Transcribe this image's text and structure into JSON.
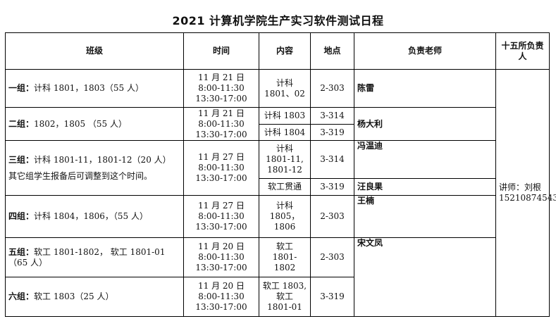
{
  "title": "2021 计算机学院生产实习软件测试日程",
  "headers": {
    "class": "班级",
    "time": "时间",
    "content": "内容",
    "location": "地点",
    "teacher": "负责老师",
    "leader": "十五所负责人"
  },
  "rows": [
    {
      "group_label": "一组：",
      "group_text": "计科 1801，1803（55 人）",
      "time": "11 月 21 日\n8:00-11:30\n13:30-17:00",
      "content": "计科 1801、02",
      "location": "2-303",
      "teacher": "陈雷"
    },
    {
      "group_label": "二组：",
      "group_text": "1802，1805 （55 人）",
      "time": "11 月 21 日\n8:00-11:30\n13:30-17:00",
      "sessions": [
        {
          "content": "计科 1803",
          "location": "3-314"
        },
        {
          "content": "计科 1804",
          "location": "3-319"
        }
      ],
      "teacher": "杨大利"
    },
    {
      "group_label": "三组：",
      "group_text": "计科 1801-11，1801-12（20 人）",
      "note": "其它组学生报备后可调整到这个时间。",
      "time": "11 月 27 日\n8:00-11:30\n13:30-17:00",
      "sessions": [
        {
          "content": "计科\n1801-11,\n1801-12",
          "location": "3-314",
          "teacher": "冯温迪"
        },
        {
          "content": "软工贯通",
          "location": "3-319",
          "teacher": "汪良果"
        }
      ]
    },
    {
      "group_label": "四组：",
      "group_text": "计科 1804，1806，（55 人）",
      "time": "11 月 27 日\n8:00-11:30\n13:30-17:00",
      "content": "计科 1805，1806",
      "location": "2-303",
      "teacher": "王楠"
    },
    {
      "group_label": "五组：",
      "group_text": "软工 1801-1802， 软工 1801-01（65 人）",
      "time": "11 月 20 日\n8:00-11:30\n13:30-17:00",
      "content": "软工\n1801-1802",
      "location": "2-303",
      "teacher": "宋文凤"
    },
    {
      "group_label": "六组：",
      "group_text": "软工 1803（25 人）",
      "time": "11 月 20 日\n8:00-11:30\n13:30-17:00",
      "content": "软工 1803,\n软工\n1801-01",
      "location": "3-319",
      "teacher": ""
    }
  ],
  "leader": {
    "title": "讲师：刘根",
    "phone": "15210874543"
  }
}
